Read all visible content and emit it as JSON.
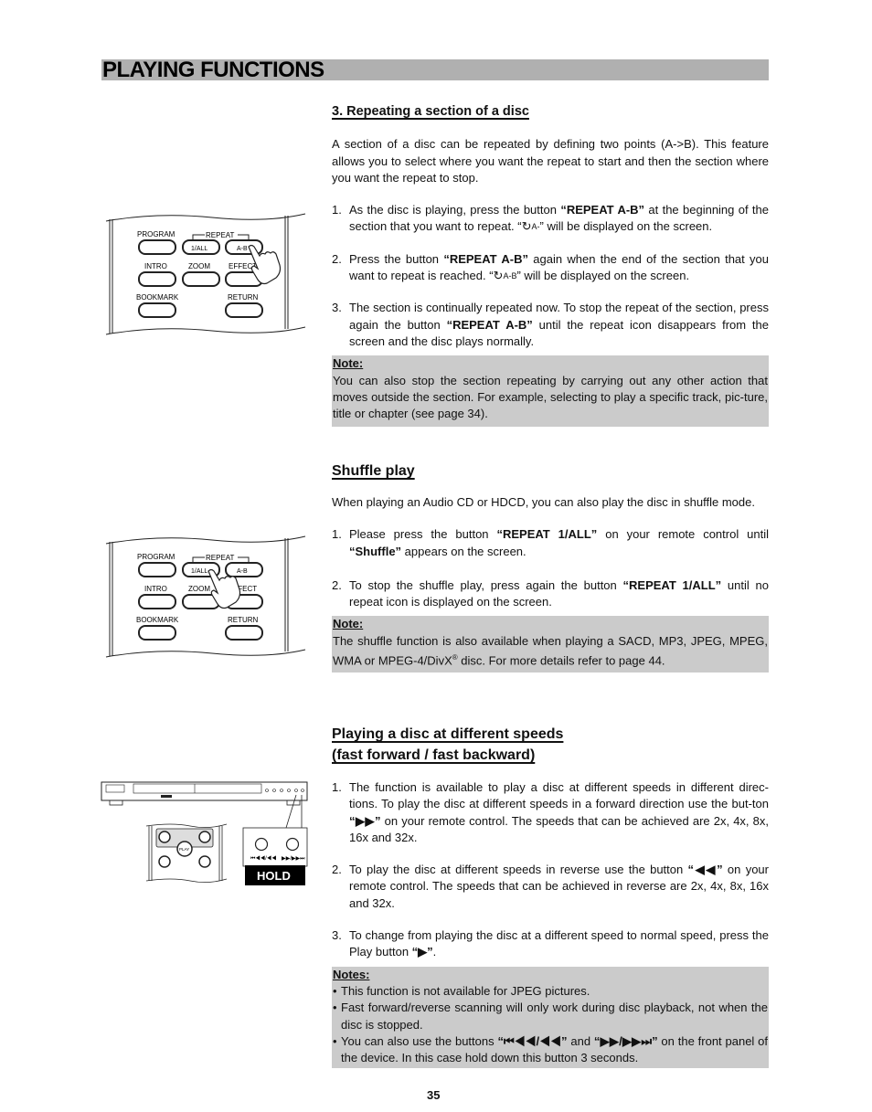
{
  "page": {
    "title": "PLAYING FUNCTIONS",
    "page_number": "35"
  },
  "repeat_section": {
    "heading": "3. Repeating a section of a disc",
    "intro": "A section of a disc can be repeated by defining two points (A->B). This feature allows you to select where you want the repeat to start and then the section where you want the repeat to stop.",
    "steps": [
      {
        "num": "1.",
        "pre": "As the disc is playing, press the button ",
        "bold": "“REPEAT A-B”",
        "mid": " at the beginning of the section that you want to repeat. “",
        "icon": "repeat-a-icon",
        "icon_label": "A-",
        "post": "” will be displayed on the screen."
      },
      {
        "num": "2.",
        "pre": "Press the button ",
        "bold": "“REPEAT A-B”",
        "mid": " again when the end of the section that you want to repeat is reached. “",
        "icon": "repeat-ab-icon",
        "icon_label": "A-B",
        "post": "” will be displayed on the screen."
      },
      {
        "num": "3.",
        "pre": "The section is continually repeated now. To stop the repeat of the section, press again the button ",
        "bold": "“REPEAT A-B”",
        "post": " until the repeat icon disappears from the screen and the disc plays normally."
      }
    ],
    "note_label": "Note:",
    "note_text": "You can also stop the section repeating by carrying out any other action that moves outside the section. For example, selecting to play a specific track, pic-ture, title or chapter (see page 34)."
  },
  "shuffle_section": {
    "heading": "Shuffle play",
    "intro": "When playing an Audio CD or HDCD, you can also play the disc in shuffle mode.",
    "steps": [
      {
        "num": "1.",
        "pre": "Please press the button ",
        "bold": "“REPEAT 1/ALL”",
        "mid": " on your remote control until ",
        "bold2": "“Shuffle”",
        "post": " appears on the screen."
      },
      {
        "num": "2.",
        "pre": "To stop the shuffle play, press again the button  ",
        "bold": "“REPEAT 1/ALL”",
        "post": " until no repeat icon is displayed on the screen."
      }
    ],
    "note_label": "Note:",
    "note_pre": "The shuffle function is also available when playing a SACD, MP3, JPEG, MPEG, WMA or MPEG-4/DivX",
    "note_sup": "®",
    "note_post": " disc. For more details refer to page 44."
  },
  "speed_section": {
    "heading_line1": "Playing a disc at different speeds",
    "heading_line2": "(fast forward / fast backward)",
    "steps": [
      {
        "num": "1.",
        "pre": "The function is available to play a disc at different speeds in different direc-tions. To play the disc at different speeds in a forward direction use the but-ton ",
        "bold": "“▶▶”",
        "post": " on your remote control. The speeds that can be achieved are 2x, 4x, 8x, 16x and 32x."
      },
      {
        "num": "2.",
        "pre": "To play the disc at different speeds in reverse use the button ",
        "bold": "“◀◀”",
        "post": " on your remote control. The speeds that can be achieved in reverse are 2x, 4x, 8x, 16x and 32x."
      },
      {
        "num": "3.",
        "pre": "To change from playing the disc at a different speed to normal speed, press the Play button ",
        "bold": "“▶”",
        "post": "."
      }
    ],
    "notes_label": "Notes:",
    "notes": [
      {
        "text": "This function is not available for JPEG pictures."
      },
      {
        "text": "Fast forward/reverse scanning will only work during disc playback, not when the disc is stopped."
      },
      {
        "pre": "You can also use the buttons ",
        "bold1": "“⏮◀◀/◀◀”",
        "mid": " and ",
        "bold2": "“▶▶/▶▶⏭”",
        "post": " on the front panel of the device. In this case hold down this button 3 seconds."
      }
    ]
  },
  "figures": {
    "remote": {
      "labels": {
        "program": "PROGRAM",
        "repeat": "REPEAT",
        "one_all": "1/ALL",
        "a_b": "A-B",
        "intro": "INTRO",
        "zoom": "ZOOM",
        "effect": "EFFECT",
        "bookmark": "BOOKMARK",
        "return": "RETURN"
      }
    },
    "player": {
      "play_label": "PLAY",
      "prev_label": "⏮◀◀/◀◀",
      "next_label": "▶▶/▶▶⏭",
      "hold_label": "HOLD"
    }
  }
}
